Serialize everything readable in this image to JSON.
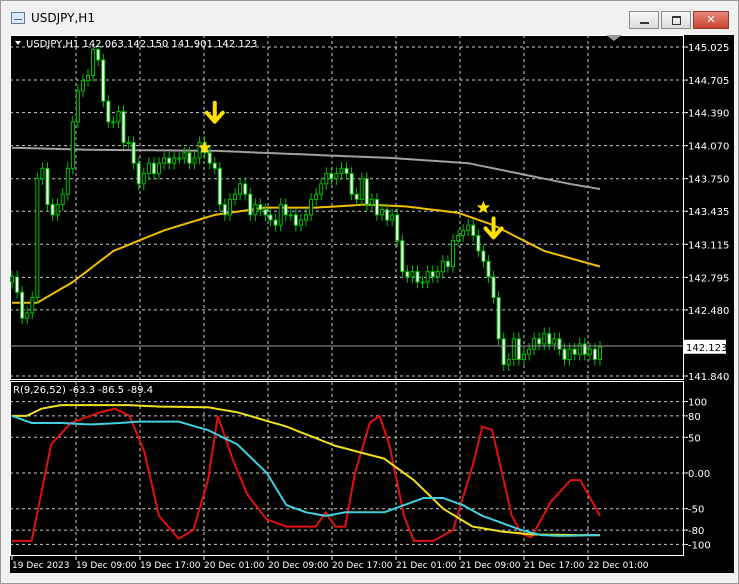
{
  "window": {
    "title": "USDJPY,H1",
    "close_glyph": "✕",
    "icons": [
      "chart-window-icon",
      "minimize-icon",
      "maximize-icon",
      "close-icon"
    ]
  },
  "chart_data": [
    {
      "type": "candlestick",
      "title": "USDJPY,H1 142.063 142.150 141.901 142.123",
      "ylim": [
        141.84,
        145.025
      ],
      "y_ticks": [
        "145.025",
        "144.705",
        "144.390",
        "144.070",
        "143.750",
        "143.435",
        "143.115",
        "142.795",
        "142.480",
        "142.123",
        "141.840"
      ],
      "current_price": "142.123",
      "x_ticks": [
        "19 Dec 2023",
        "19 Dec 09:00",
        "19 Dec 17:00",
        "20 Dec 01:00",
        "20 Dec 09:00",
        "20 Dec 17:00",
        "21 Dec 01:00",
        "21 Dec 09:00",
        "21 Dec 17:00",
        "22 Dec 01:00"
      ],
      "close": [
        142.8,
        142.65,
        142.4,
        142.45,
        142.6,
        143.75,
        143.85,
        143.5,
        143.4,
        143.5,
        143.6,
        143.85,
        144.3,
        144.6,
        144.7,
        144.75,
        145.0,
        144.9,
        144.5,
        144.3,
        144.3,
        144.4,
        144.1,
        144.1,
        143.9,
        143.7,
        143.8,
        143.9,
        143.8,
        143.9,
        143.95,
        143.9,
        143.95,
        143.95,
        144.0,
        143.9,
        143.95,
        144.1,
        144.0,
        143.9,
        143.85,
        143.5,
        143.4,
        143.55,
        143.6,
        143.7,
        143.6,
        143.4,
        143.5,
        143.45,
        143.4,
        143.35,
        143.3,
        143.5,
        143.4,
        143.4,
        143.3,
        143.35,
        143.4,
        143.55,
        143.6,
        143.7,
        143.8,
        143.75,
        143.8,
        143.85,
        143.8,
        143.6,
        143.55,
        143.75,
        143.5,
        143.55,
        143.4,
        143.45,
        143.35,
        143.4,
        143.15,
        142.85,
        142.8,
        142.85,
        142.75,
        142.75,
        142.85,
        142.8,
        142.85,
        142.95,
        142.9,
        143.15,
        143.2,
        143.25,
        143.3,
        143.2,
        143.05,
        142.95,
        142.8,
        142.6,
        142.2,
        141.95,
        142.0,
        142.2,
        142.0,
        142.05,
        142.1,
        142.2,
        142.15,
        142.25,
        142.15,
        142.2,
        142.1,
        142.0,
        142.1,
        142.05,
        142.15,
        142.05,
        142.1,
        142.0,
        142.12
      ],
      "series": [
        {
          "name": "",
          "color": "#a0a0a0",
          "anchors": [
            [
              0,
              144.05
            ],
            [
              15,
              144.03
            ],
            [
              40,
              144.02
            ],
            [
              60,
              143.98
            ],
            [
              75,
              143.95
            ],
            [
              90,
              143.9
            ],
            [
              100,
              143.8
            ],
            [
              110,
              143.7
            ],
            [
              116,
              143.65
            ]
          ]
        },
        {
          "name": "",
          "color": "#f0c000",
          "anchors": [
            [
              0,
              142.55
            ],
            [
              5,
              142.55
            ],
            [
              12,
              142.75
            ],
            [
              20,
              143.05
            ],
            [
              30,
              143.25
            ],
            [
              40,
              143.4
            ],
            [
              50,
              143.47
            ],
            [
              60,
              143.47
            ],
            [
              70,
              143.5
            ],
            [
              78,
              143.48
            ],
            [
              88,
              143.42
            ],
            [
              95,
              143.3
            ],
            [
              105,
              143.05
            ],
            [
              116,
              142.9
            ]
          ]
        }
      ],
      "markers": [
        {
          "type": "star",
          "index": 38,
          "value": 144.05
        },
        {
          "type": "arrow-down",
          "index": 40,
          "value": 144.35
        },
        {
          "type": "star",
          "index": 93,
          "value": 143.47
        },
        {
          "type": "arrow-down",
          "index": 95,
          "value": 143.23
        }
      ]
    },
    {
      "type": "line",
      "title": "R(9,26,52) -63.3 -86.5 -89.4",
      "ylim": [
        -105,
        105
      ],
      "y_ticks": [
        {
          "label": "100",
          "value": 100
        },
        {
          "label": "80",
          "value": 80
        },
        {
          "label": "50",
          "value": 50
        },
        {
          "label": "0.00",
          "value": 0
        },
        {
          "label": "-50",
          "value": -50
        },
        {
          "label": "-80",
          "value": -80
        },
        {
          "label": "-100",
          "value": -100
        }
      ],
      "series": [
        {
          "name": "",
          "color": "#e01010",
          "anchors": [
            [
              0,
              -95
            ],
            [
              4,
              -95
            ],
            [
              8,
              40
            ],
            [
              12,
              70
            ],
            [
              18,
              85
            ],
            [
              21,
              90
            ],
            [
              24,
              80
            ],
            [
              27,
              30
            ],
            [
              30,
              -60
            ],
            [
              34,
              -92
            ],
            [
              37,
              -80
            ],
            [
              40,
              -10
            ],
            [
              42,
              80
            ],
            [
              45,
              20
            ],
            [
              48,
              -30
            ],
            [
              52,
              -65
            ],
            [
              56,
              -75
            ],
            [
              60,
              -75
            ],
            [
              62,
              -75
            ],
            [
              64,
              -55
            ],
            [
              66,
              -75
            ],
            [
              68,
              -75
            ],
            [
              70,
              0
            ],
            [
              73,
              70
            ],
            [
              75,
              80
            ],
            [
              77,
              40
            ],
            [
              80,
              -60
            ],
            [
              82,
              -95
            ],
            [
              86,
              -95
            ],
            [
              90,
              -80
            ],
            [
              94,
              10
            ],
            [
              96,
              65
            ],
            [
              98,
              60
            ],
            [
              102,
              -60
            ],
            [
              104,
              -85
            ],
            [
              106,
              -90
            ],
            [
              110,
              -40
            ],
            [
              114,
              -10
            ],
            [
              116,
              -10
            ],
            [
              118,
              -35
            ],
            [
              120,
              -60
            ]
          ]
        },
        {
          "name": "",
          "color": "#f0e020",
          "anchors": [
            [
              0,
              80
            ],
            [
              3,
              80
            ],
            [
              6,
              90
            ],
            [
              10,
              95
            ],
            [
              16,
              95
            ],
            [
              24,
              95
            ],
            [
              30,
              93
            ],
            [
              40,
              92
            ],
            [
              46,
              85
            ],
            [
              56,
              65
            ],
            [
              66,
              38
            ],
            [
              76,
              20
            ],
            [
              82,
              -10
            ],
            [
              88,
              -50
            ],
            [
              94,
              -75
            ],
            [
              100,
              -82
            ],
            [
              106,
              -86
            ],
            [
              116,
              -87
            ],
            [
              120,
              -87
            ]
          ]
        },
        {
          "name": "",
          "color": "#40d0e0",
          "anchors": [
            [
              0,
              80
            ],
            [
              4,
              70
            ],
            [
              10,
              70
            ],
            [
              16,
              68
            ],
            [
              22,
              70
            ],
            [
              26,
              72
            ],
            [
              34,
              72
            ],
            [
              40,
              60
            ],
            [
              46,
              40
            ],
            [
              52,
              0
            ],
            [
              56,
              -45
            ],
            [
              60,
              -55
            ],
            [
              64,
              -60
            ],
            [
              68,
              -55
            ],
            [
              72,
              -55
            ],
            [
              76,
              -55
            ],
            [
              80,
              -45
            ],
            [
              84,
              -35
            ],
            [
              88,
              -35
            ],
            [
              92,
              -45
            ],
            [
              96,
              -60
            ],
            [
              100,
              -70
            ],
            [
              104,
              -80
            ],
            [
              108,
              -87
            ],
            [
              112,
              -88
            ],
            [
              120,
              -87
            ]
          ]
        }
      ]
    }
  ]
}
